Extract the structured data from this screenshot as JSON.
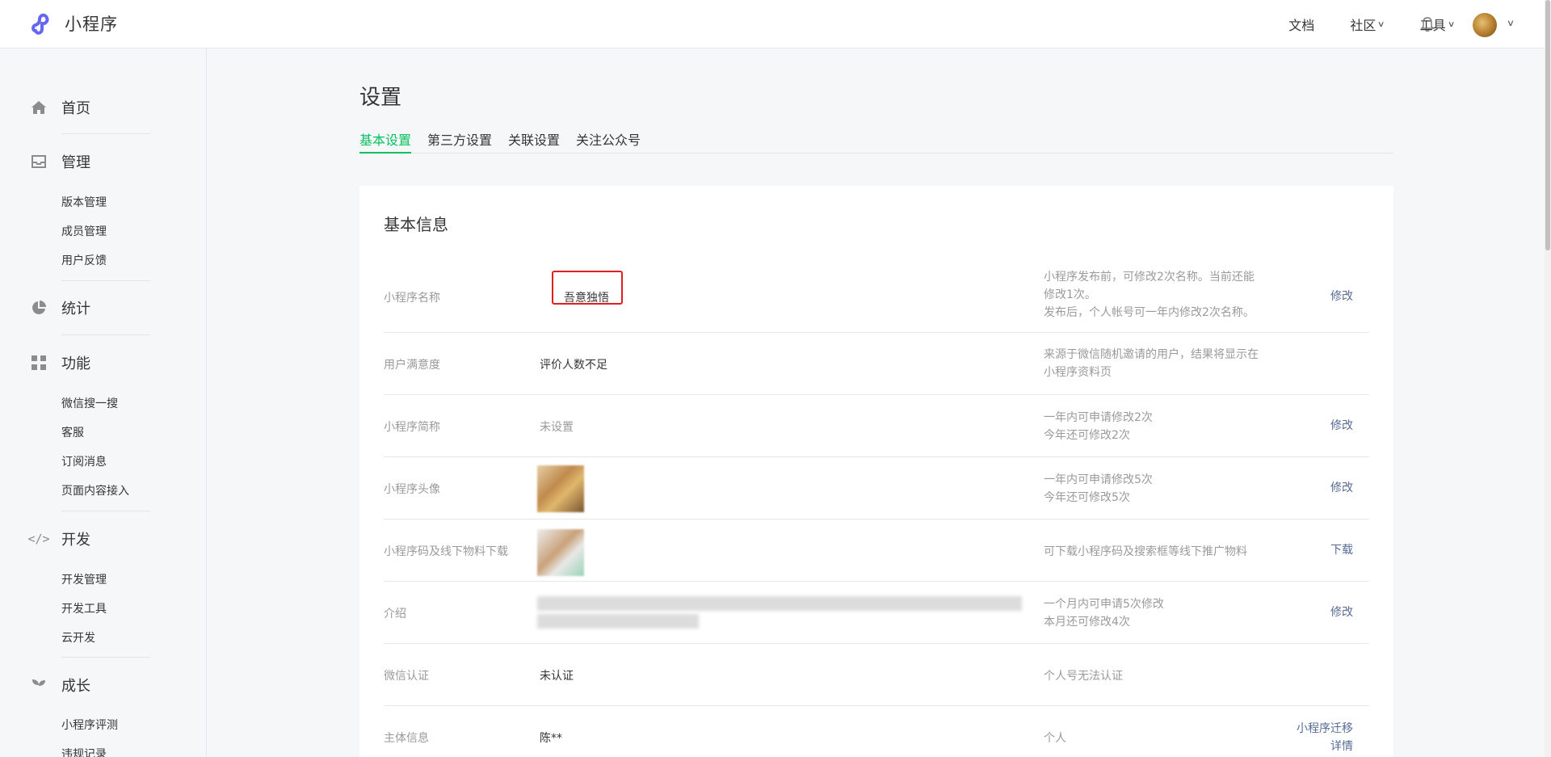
{
  "app": {
    "brand": "小程序"
  },
  "topnav": {
    "docs": "文档",
    "community": "社区",
    "tools": "工具"
  },
  "sidebar": {
    "home": "首页",
    "manage": {
      "title": "管理",
      "items": [
        "版本管理",
        "成员管理",
        "用户反馈"
      ]
    },
    "stats": "统计",
    "features": {
      "title": "功能",
      "items": [
        "微信搜一搜",
        "客服",
        "订阅消息",
        "页面内容接入"
      ]
    },
    "dev": {
      "title": "开发",
      "items": [
        "开发管理",
        "开发工具",
        "云开发"
      ]
    },
    "growth": {
      "title": "成长",
      "items": [
        "小程序评测",
        "违规记录"
      ]
    }
  },
  "page": {
    "title": "设置",
    "tabs": [
      "基本设置",
      "第三方设置",
      "关联设置",
      "关注公众号"
    ],
    "active_tab": 0
  },
  "basic_info": {
    "title": "基本信息",
    "rows": [
      {
        "label": "小程序名称",
        "value": "吾意独悟",
        "tip": "小程序发布前，可修改2次名称。当前还能修改1次。\n发布后，个人帐号可一年内修改2次名称。",
        "action": "修改"
      },
      {
        "label": "用户满意度",
        "value": "评价人数不足",
        "tip": "来源于微信随机邀请的用户，结果将显示在小程序资料页",
        "action": ""
      },
      {
        "label": "小程序简称",
        "value": "未设置",
        "tip": "一年内可申请修改2次\n今年还可修改2次",
        "action": "修改"
      },
      {
        "label": "小程序头像",
        "value": "",
        "tip": "一年内可申请修改5次\n今年还可修改5次",
        "action": "修改"
      },
      {
        "label": "小程序码及线下物料下载",
        "value": "",
        "tip": "可下载小程序码及搜索框等线下推广物料",
        "action": "下载"
      },
      {
        "label": "介绍",
        "value": "",
        "tip": "一个月内可申请5次修改\n本月还可修改4次",
        "action": "修改"
      },
      {
        "label": "微信认证",
        "value": "未认证",
        "tip": "个人号无法认证",
        "action": ""
      },
      {
        "label": "主体信息",
        "value": "陈**",
        "tip": "个人",
        "action": "小程序迁移",
        "action2": "详情"
      }
    ]
  },
  "colors": {
    "accent": "#07c160",
    "link": "#576b95",
    "highlight": "#e02020"
  }
}
